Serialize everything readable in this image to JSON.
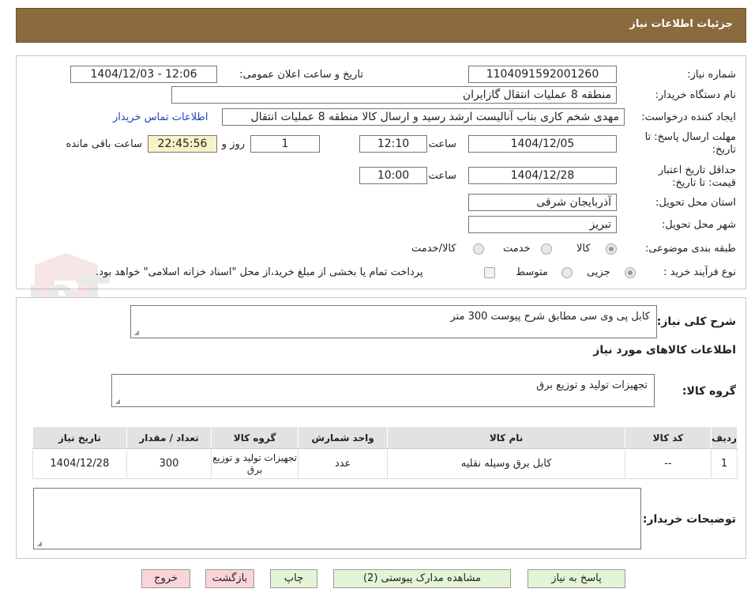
{
  "header": {
    "title": "جزئیات اطلاعات نیاز"
  },
  "form": {
    "need_number_label": "شماره نیاز:",
    "need_number": "1104091592001260",
    "announce_label": "تاریخ و ساعت اعلان عمومی:",
    "announce_value": "1404/12/03 - 12:06",
    "buyer_org_label": "نام دستگاه خریدار:",
    "buyer_org": "منطقه 8 عملیات انتقال گازایران",
    "creator_label": "ایجاد کننده درخواست:",
    "creator": "مهدی شخم کاری بناب آنالیست ارشد رسید و ارسال کالا منطقه 8 عملیات انتقال",
    "contact_link": "اطلاعات تماس خریدار",
    "deadline_label_1": "مهلت ارسال پاسخ: تا",
    "deadline_label_2": "تاریخ:",
    "deadline_date": "1404/12/05",
    "time_label": "ساعت",
    "deadline_time": "12:10",
    "days_value": "1",
    "days_label": "روز و",
    "remaining_time": "22:45:56",
    "remaining_label": "ساعت باقی مانده",
    "validity_label_1": "حداقل تاریخ اعتبار",
    "validity_label_2": "قیمت: تا تاریخ:",
    "validity_date": "1404/12/28",
    "validity_time": "10:00",
    "province_label": "استان محل تحویل:",
    "province": "آذربایجان شرقی",
    "city_label": "شهر محل تحویل:",
    "city": "تبریز",
    "category_label": "طبقه بندی موضوعی:",
    "category_options": [
      "کالا",
      "خدمت",
      "کالا/خدمت"
    ],
    "process_label": "نوع فرآیند خرید :",
    "process_options": [
      "جزیی",
      "متوسط"
    ],
    "payment_note": "پرداخت تمام یا بخشی از مبلغ خرید،از محل \"اسناد خزانه اسلامی\" خواهد بود."
  },
  "description": {
    "label": "شرح کلی نیاز:",
    "value": "کابل پی وی سی مطابق شرح پیوست 300 متر"
  },
  "goods_info": {
    "section_title": "اطلاعات کالاهای مورد نیاز",
    "group_label": "گروه کالا:",
    "group_value": "تجهیزات تولید و توزیع برق"
  },
  "table": {
    "headers": [
      "ردیف",
      "کد کالا",
      "نام کالا",
      "واحد شمارش",
      "گروه کالا",
      "تعداد / مقدار",
      "تاریخ نیاز"
    ],
    "rows": [
      [
        "1",
        "--",
        "کابل برق وسیله نقلیه",
        "عدد",
        "تجهیزات تولید و توزیع برق",
        "300",
        "1404/12/28"
      ]
    ]
  },
  "buyer_notes": {
    "label": "توضیحات خریدار:",
    "value": ""
  },
  "buttons": {
    "reply": "پاسخ به نیاز",
    "attachments": "مشاهده مدارک پیوستی (2)",
    "print": "چاپ",
    "back": "بازگشت",
    "exit": "خروج"
  },
  "watermark": "AriaTender.neT",
  "colors": {
    "header_bg": "#8b6a3d",
    "link": "#1a44b8",
    "highlight": "#f6f3c8",
    "button_green": "#e3f4d6",
    "button_pink": "#f9d4d8"
  }
}
